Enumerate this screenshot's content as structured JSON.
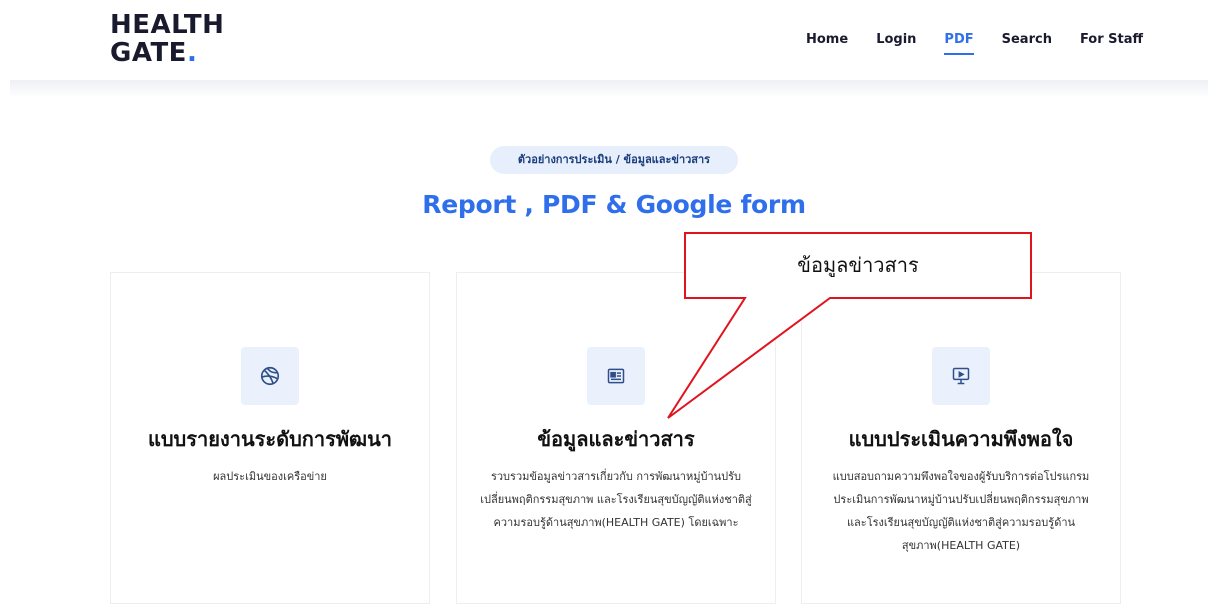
{
  "header": {
    "logo_line1": "HEALTH",
    "logo_line2": "GATE",
    "logo_dot": ".",
    "nav": [
      "Home",
      "Login",
      "PDF",
      "Search",
      "For Staff"
    ],
    "active_nav": "PDF"
  },
  "breadcrumb": "ตัวอย่างการประเมิน / ข้อมูลและข่าวสาร",
  "section_title": "Report , PDF & Google form",
  "cards": [
    {
      "icon": "dribbble-icon",
      "title": "แบบรายงานระดับการพัฒนา",
      "description": "ผลประเมินของเครือข่าย"
    },
    {
      "icon": "newspaper-icon",
      "title": "ข้อมูลและข่าวสาร",
      "description": "รวบรวมข้อมูลข่าวสารเกี่ยวกับ การพัฒนาหมู่บ้านปรับเปลี่ยนพฤติกรรมสุขภาพ และโรงเรียนสุขบัญญัติแห่งชาติสู่ความรอบรู้ด้านสุขภาพ(HEALTH GATE) โดยเฉพาะ"
    },
    {
      "icon": "presentation-icon",
      "title": "แบบประเมินความพึงพอใจ",
      "description": "แบบสอบถามความพึงพอใจของผู้รับบริการต่อโปรแกรมประเมินการพัฒนาหมู่บ้านปรับเปลี่ยนพฤติกรรมสุขภาพ และโรงเรียนสุขบัญญัติแห่งชาติสู่ความรอบรู้ด้านสุขภาพ(HEALTH GATE)"
    }
  ],
  "callout": "ข้อมูลข่าวสาร",
  "colors": {
    "accent": "#2f6fec",
    "callout_border": "#e0141e",
    "icon_bg": "#eaf1fc"
  }
}
